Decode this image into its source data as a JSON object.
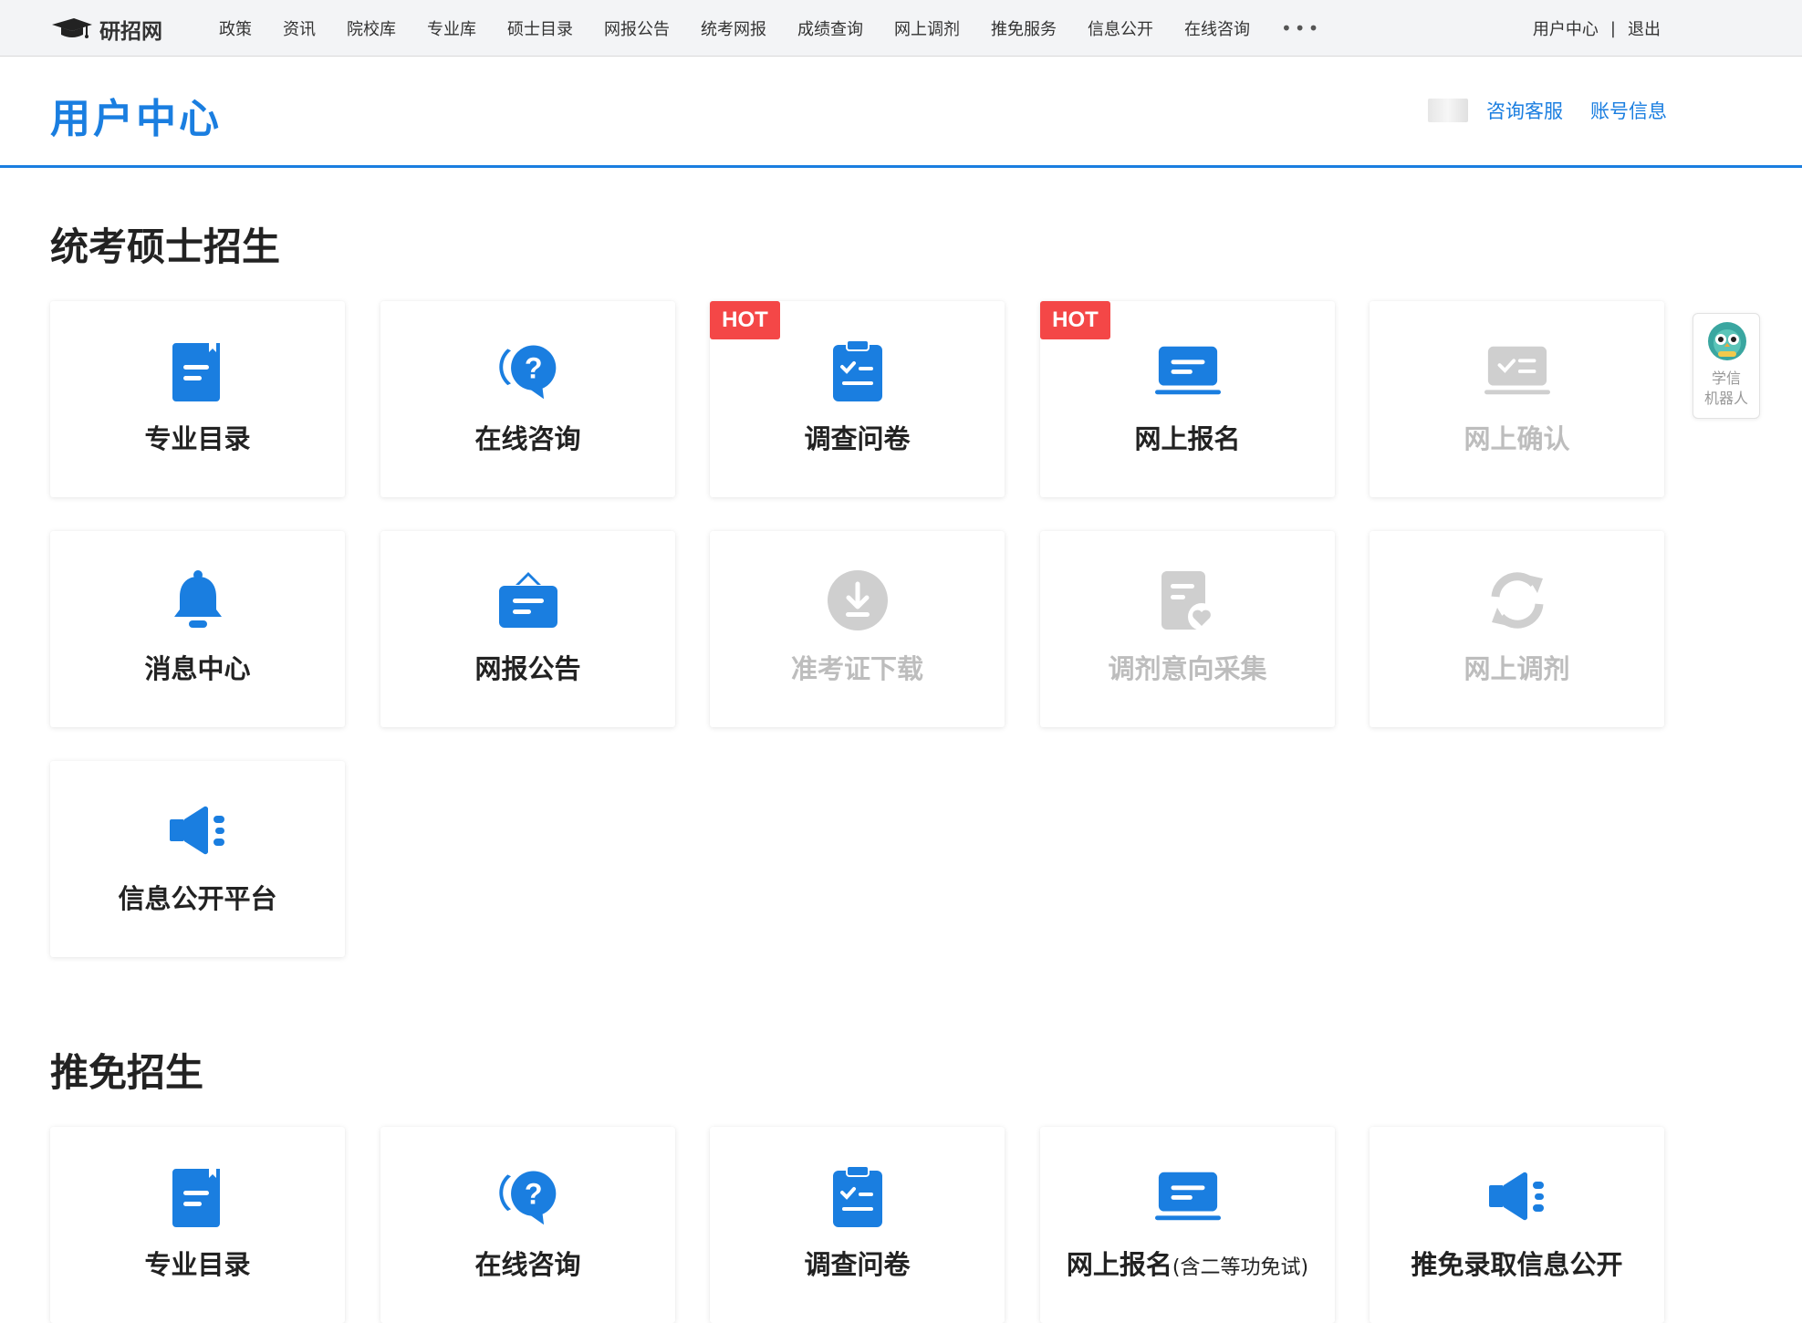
{
  "topnav": {
    "logo_text": "研招网",
    "items": [
      "政策",
      "资讯",
      "院校库",
      "专业库",
      "硕士目录",
      "网报公告",
      "统考网报",
      "成绩查询",
      "网上调剂",
      "推免服务",
      "信息公开",
      "在线咨询"
    ],
    "more": "•••",
    "user_center": "用户中心",
    "separator": "|",
    "logout": "退出"
  },
  "header": {
    "title": "用户中心",
    "consult_service": "咨询客服",
    "account_info": "账号信息"
  },
  "sections": [
    {
      "title": "统考硕士招生",
      "cards": [
        {
          "label": "专业目录",
          "icon": "catalog-icon",
          "enabled": true
        },
        {
          "label": "在线咨询",
          "icon": "consult-icon",
          "enabled": true
        },
        {
          "label": "调查问卷",
          "icon": "clipboard-icon",
          "enabled": true,
          "badge": "HOT"
        },
        {
          "label": "网上报名",
          "icon": "laptop-icon",
          "enabled": true,
          "badge": "HOT"
        },
        {
          "label": "网上确认",
          "icon": "confirm-icon",
          "enabled": false
        },
        {
          "label": "消息中心",
          "icon": "bell-icon",
          "enabled": true
        },
        {
          "label": "网报公告",
          "icon": "notice-board-icon",
          "enabled": true
        },
        {
          "label": "准考证下载",
          "icon": "download-icon",
          "enabled": false
        },
        {
          "label": "调剂意向采集",
          "icon": "document-heart-icon",
          "enabled": false
        },
        {
          "label": "网上调剂",
          "icon": "refresh-icon",
          "enabled": false
        },
        {
          "label": "信息公开平台",
          "icon": "megaphone-icon",
          "enabled": true
        }
      ]
    },
    {
      "title": "推免招生",
      "cards": [
        {
          "label": "专业目录",
          "icon": "catalog-icon",
          "enabled": true
        },
        {
          "label": "在线咨询",
          "icon": "consult-icon",
          "enabled": true
        },
        {
          "label": "调查问卷",
          "icon": "clipboard-icon",
          "enabled": true
        },
        {
          "label": "网上报名",
          "label_suffix": "(含二等功免试)",
          "icon": "laptop-icon",
          "enabled": true
        },
        {
          "label": "推免录取信息公开",
          "icon": "megaphone-icon",
          "enabled": true
        }
      ]
    }
  ],
  "robot": {
    "line1": "学信",
    "line2": "机器人"
  },
  "colors": {
    "brand_blue": "#1a7ee0",
    "hot_red": "#f44747",
    "disabled_gray": "#bdbdbd"
  }
}
